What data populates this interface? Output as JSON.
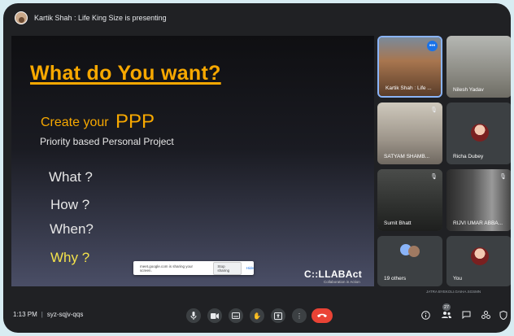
{
  "topbar": {
    "presenter_text": "Kartik Shah : Life King Size is presenting"
  },
  "slide": {
    "title": "What do You want?",
    "create_text": "Create your",
    "ppp": "PPP",
    "subtitle": "Priority based Personal Project",
    "questions": [
      "What ?",
      "How ?",
      "When?"
    ],
    "why": "Why ?",
    "share_notice": "meet.google.com is sharing your screen.",
    "stop_sharing": "Stop sharing",
    "hide": "Hide",
    "logo": "C::LLABAct",
    "logo_sub": "Collaboration in Action"
  },
  "participants": [
    {
      "name": "Kartik Shah : Life ...",
      "active": true
    },
    {
      "name": "Nilesh Yadav"
    },
    {
      "name": "SATYAM SHAMB..."
    },
    {
      "name": "Richa Dubey"
    },
    {
      "name": "Sumit Bhatt"
    },
    {
      "name": "RIJVI UMAR ABBA..."
    },
    {
      "name": "19 others"
    },
    {
      "name": "You"
    }
  ],
  "watermark": "JATRA BYEKOLI.GAIHA.SGSMN",
  "bottombar": {
    "time": "1:13 PM",
    "meeting_code": "syz-sqjv-qqs",
    "people_count": "27"
  },
  "icons": {
    "mic": "mic-icon",
    "camera": "camera-icon",
    "captions": "captions-icon",
    "raise_hand": "raise-hand-icon",
    "present": "present-icon",
    "more": "more-options-icon",
    "end_call": "end-call-icon",
    "info": "info-icon",
    "people": "people-icon",
    "chat": "chat-icon",
    "activities": "activities-icon",
    "host_controls": "shield-icon"
  },
  "colors": {
    "accent": "#8ab4f8",
    "end_call": "#ea4335",
    "slide_title": "#f7a800",
    "why": "#f3e24b"
  }
}
